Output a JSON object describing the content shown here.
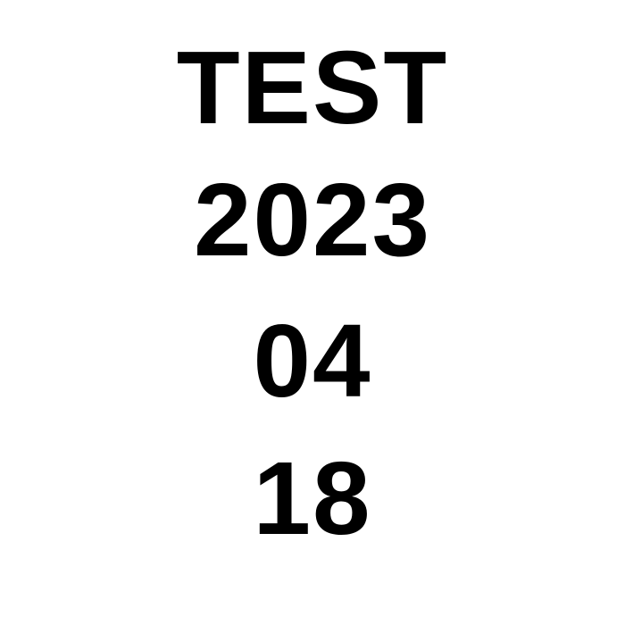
{
  "lines": [
    "TEST",
    "2023",
    "04",
    "18"
  ],
  "colors": {
    "text": "#000000",
    "background": "#ffffff"
  }
}
